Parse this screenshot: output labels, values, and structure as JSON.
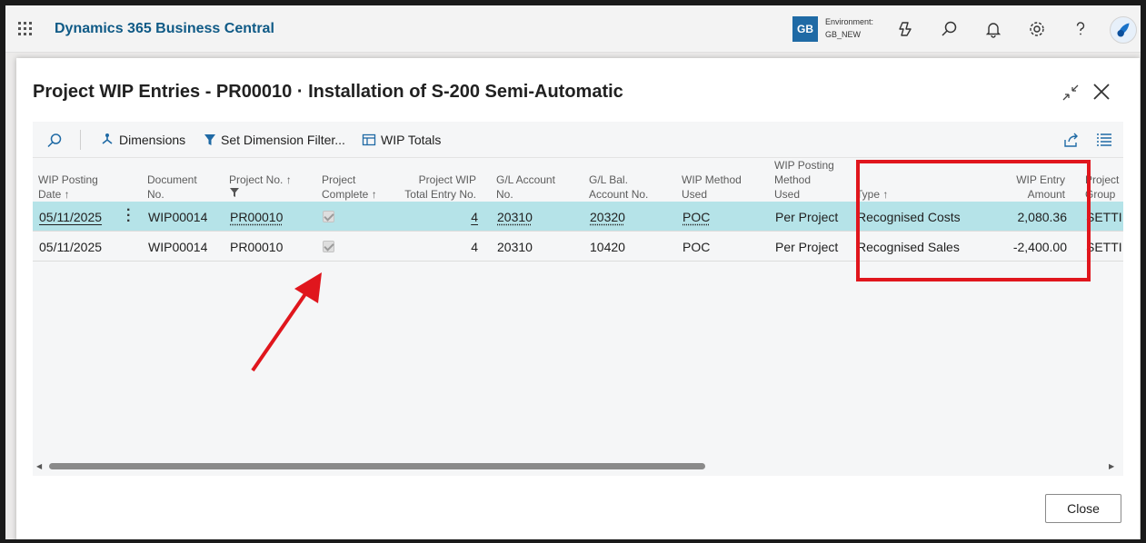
{
  "topbar": {
    "app_title": "Dynamics 365 Business Central",
    "env_badge": "GB",
    "env_label": "Environment:",
    "env_name": "GB_NEW"
  },
  "dialog": {
    "title": "Project WIP Entries - PR00010 · Installation of S-200 Semi-Automatic",
    "close_button": "Close"
  },
  "actions": {
    "dimensions": "Dimensions",
    "set_dimension_filter": "Set Dimension Filter...",
    "wip_totals": "WIP Totals"
  },
  "columns": {
    "wip_posting_date": [
      "WIP Posting",
      "Date ↑"
    ],
    "document_no": [
      "Document",
      "No."
    ],
    "project_no": [
      "Project No. ↑"
    ],
    "project_complete": [
      "Project",
      "Complete ↑"
    ],
    "project_wip_total": [
      "Project WIP",
      "Total Entry No."
    ],
    "gl_account": [
      "G/L Account",
      "No."
    ],
    "gl_bal_account": [
      "G/L Bal.",
      "Account No."
    ],
    "wip_method": [
      "WIP Method",
      "Used"
    ],
    "wip_posting_method": [
      "WIP Posting",
      "Method",
      "Used"
    ],
    "type": [
      "Type ↑"
    ],
    "wip_entry_amount": [
      "WIP Entry",
      "Amount"
    ],
    "project_group": [
      "Project",
      "Group"
    ]
  },
  "rows": [
    {
      "date": "05/11/2025",
      "document_no": "WIP00014",
      "project_no": "PR00010",
      "project_complete": true,
      "wip_total_entry_no": "4",
      "gl_account": "20310",
      "gl_bal_account": "20320",
      "wip_method": "POC",
      "wip_posting_method": "Per Project",
      "type": "Recognised Costs",
      "amount": "2,080.36",
      "group": "SETTI"
    },
    {
      "date": "05/11/2025",
      "document_no": "WIP00014",
      "project_no": "PR00010",
      "project_complete": true,
      "wip_total_entry_no": "4",
      "gl_account": "20310",
      "gl_bal_account": "10420",
      "wip_method": "POC",
      "wip_posting_method": "Per Project",
      "type": "Recognised Sales",
      "amount": "-2,400.00",
      "group": "SETTI"
    }
  ],
  "annotations": {
    "highlight_color": "#e0161d",
    "arrow_color": "#e0161d"
  },
  "colors": {
    "selected_row": "#b5e3e8",
    "brand_title": "#0f5a86",
    "action_icon": "#1f6aa5"
  }
}
